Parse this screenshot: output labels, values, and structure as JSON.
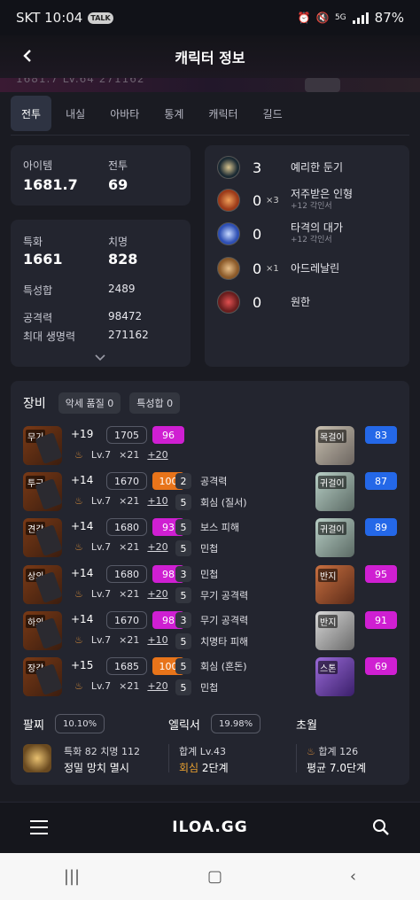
{
  "status": {
    "carrier_time": "SKT 10:04",
    "talk": "TALK",
    "network": "5G",
    "battery": "87%"
  },
  "header": {
    "title": "캐릭터 정보",
    "ghost": "1681.7   LV.64   271162"
  },
  "tabs": [
    "전투",
    "내실",
    "아바타",
    "통계",
    "캐릭터",
    "길드"
  ],
  "summary": {
    "item_level_label": "아이템",
    "item_level": "1681.7",
    "battle_label": "전투",
    "battle": "69"
  },
  "stats": {
    "spec_label": "특화",
    "spec": "1661",
    "crit_label": "치명",
    "crit": "828",
    "total_label": "특성합",
    "total": "2489",
    "atk_label": "공격력",
    "atk": "98472",
    "hp_label": "최대 생명력",
    "hp": "271162"
  },
  "engravings": [
    {
      "num": "3",
      "x": "",
      "name": "예리한 둔기",
      "sub": "",
      "color": "#1b2a33"
    },
    {
      "num": "0",
      "x": "×3",
      "name": "저주받은 인형",
      "sub": "+12 각인서",
      "color": "#9c3b1a"
    },
    {
      "num": "0",
      "x": "",
      "name": "타격의 대가",
      "sub": "+12 각인서",
      "color": "#2e4fb3"
    },
    {
      "num": "0",
      "x": "×1",
      "name": "아드레날린",
      "sub": "",
      "color": "#8b5a2a"
    },
    {
      "num": "0",
      "x": "",
      "name": "원한",
      "sub": "",
      "color": "#6a1e1e"
    }
  ],
  "equipment": {
    "title": "장비",
    "quality_pill": "악세 품질 0",
    "stat_pill": "특성합 0",
    "gear": [
      {
        "name": "무기",
        "hone": "+19",
        "ilvl": "1705",
        "quality": "96",
        "qcolor": "#cf1fd2",
        "lv": "Lv.7",
        "x": "×21",
        "plus": "+20"
      },
      {
        "name": "투구",
        "hone": "+14",
        "ilvl": "1670",
        "quality": "100",
        "qcolor": "#e8741a",
        "lv": "Lv.7",
        "x": "×21",
        "plus": "+10"
      },
      {
        "name": "견갑",
        "hone": "+14",
        "ilvl": "1680",
        "quality": "93",
        "qcolor": "#cf1fd2",
        "lv": "Lv.7",
        "x": "×21",
        "plus": "+20"
      },
      {
        "name": "상의",
        "hone": "+14",
        "ilvl": "1680",
        "quality": "98",
        "qcolor": "#cf1fd2",
        "lv": "Lv.7",
        "x": "×21",
        "plus": "+20"
      },
      {
        "name": "하의",
        "hone": "+14",
        "ilvl": "1670",
        "quality": "98",
        "qcolor": "#cf1fd2",
        "lv": "Lv.7",
        "x": "×21",
        "plus": "+10"
      },
      {
        "name": "장갑",
        "hone": "+15",
        "ilvl": "1685",
        "quality": "100",
        "qcolor": "#e8741a",
        "lv": "Lv.7",
        "x": "×21",
        "plus": "+20"
      }
    ],
    "engrave_nodes": [
      {
        "n": "2",
        "t": "공격력"
      },
      {
        "n": "5",
        "t": "회심 (질서)"
      },
      {
        "n": "5",
        "t": "보스 피해"
      },
      {
        "n": "5",
        "t": "민첩"
      },
      {
        "n": "3",
        "t": "민첩"
      },
      {
        "n": "5",
        "t": "무기 공격력"
      },
      {
        "n": "3",
        "t": "무기 공격력"
      },
      {
        "n": "5",
        "t": "치명타 피해"
      },
      {
        "n": "5",
        "t": "회심 (혼돈)"
      },
      {
        "n": "5",
        "t": "민첩"
      }
    ],
    "accessories": [
      {
        "name": "목걸이",
        "quality": "83",
        "qcolor": "#2468e8"
      },
      {
        "name": "귀걸이",
        "quality": "87",
        "qcolor": "#2468e8"
      },
      {
        "name": "귀걸이",
        "quality": "89",
        "qcolor": "#2468e8"
      },
      {
        "name": "반지",
        "quality": "95",
        "qcolor": "#cf1fd2"
      },
      {
        "name": "반지",
        "quality": "91",
        "qcolor": "#cf1fd2"
      },
      {
        "name": "스톤",
        "quality": "69",
        "qcolor": "#cf1fd2"
      }
    ]
  },
  "bottom": {
    "bracelet_label": "팔찌",
    "bracelet_pct": "10.10%",
    "bracelet_line1": "특화 82  치명 112",
    "bracelet_line2": "정밀 망치 멸시",
    "elixir_label": "엘릭서",
    "elixir_pct": "19.98%",
    "elixir_line1": "합계 Lv.43",
    "elixir_line2_a": "회심",
    "elixir_line2_b": "2단계",
    "transcend_label": "초월",
    "transcend_line1": "합계 126",
    "transcend_line2": "평균 7.0단계"
  },
  "nav": {
    "logo": "ILOA.GG"
  }
}
